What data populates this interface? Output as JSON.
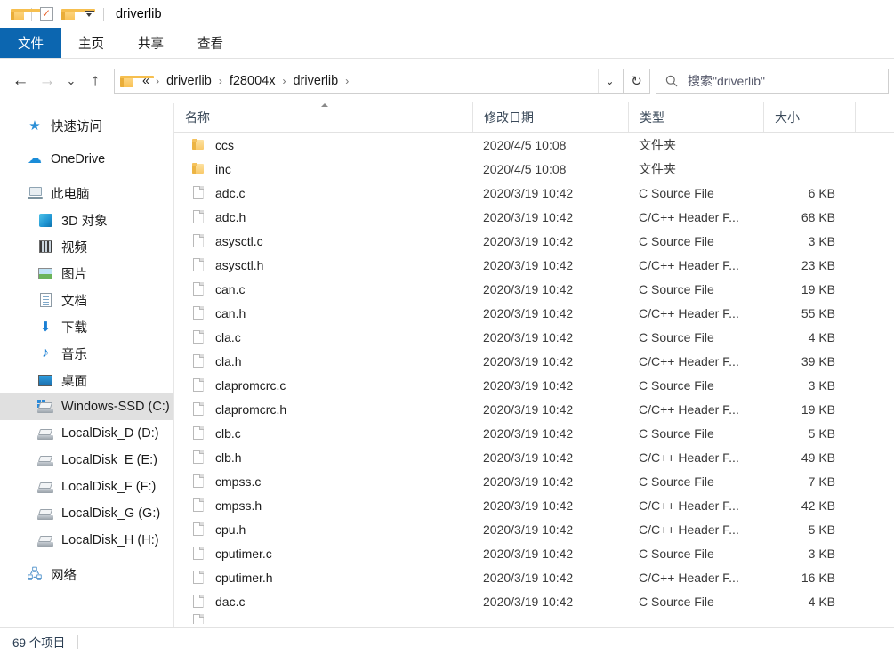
{
  "window": {
    "title": "driverlib"
  },
  "quick_access_toolbar": {
    "buttons": [
      {
        "name": "folder-icon",
        "label": ""
      },
      {
        "name": "properties-icon",
        "label": ""
      },
      {
        "name": "new-folder-icon",
        "label": ""
      },
      {
        "name": "customize-qat-icon",
        "label": ""
      }
    ]
  },
  "ribbon": {
    "tabs": [
      {
        "label": "文件",
        "active": true
      },
      {
        "label": "主页",
        "active": false
      },
      {
        "label": "共享",
        "active": false
      },
      {
        "label": "查看",
        "active": false
      }
    ]
  },
  "navigation": {
    "back_icon": "←",
    "forward_icon": "→",
    "recent_icon": "⌄",
    "up_icon": "↑",
    "refresh_icon": "↻",
    "dropdown_icon": "⌄"
  },
  "address_bar": {
    "ellipsis": "«",
    "separator": "›",
    "crumbs": [
      "driverlib",
      "f28004x",
      "driverlib"
    ]
  },
  "search": {
    "placeholder": "搜索\"driverlib\"",
    "value": "",
    "icon": "search-icon"
  },
  "sidebar": {
    "items": [
      {
        "label": "快速访问",
        "icon": "star-icon",
        "level": 1,
        "selected": false
      },
      {
        "label": "OneDrive",
        "icon": "cloud-icon",
        "level": 1,
        "selected": false
      },
      {
        "label": "此电脑",
        "icon": "computer-icon",
        "level": 1,
        "selected": false
      },
      {
        "label": "3D 对象",
        "icon": "cube-icon",
        "level": 2,
        "selected": false
      },
      {
        "label": "视频",
        "icon": "video-icon",
        "level": 2,
        "selected": false
      },
      {
        "label": "图片",
        "icon": "picture-icon",
        "level": 2,
        "selected": false
      },
      {
        "label": "文档",
        "icon": "document-icon",
        "level": 2,
        "selected": false
      },
      {
        "label": "下载",
        "icon": "download-icon",
        "level": 2,
        "selected": false
      },
      {
        "label": "音乐",
        "icon": "music-icon",
        "level": 2,
        "selected": false
      },
      {
        "label": "桌面",
        "icon": "desktop-icon",
        "level": 2,
        "selected": false
      },
      {
        "label": "Windows-SSD (C:)",
        "icon": "windows-drive-icon",
        "level": 2,
        "selected": true
      },
      {
        "label": "LocalDisk_D (D:)",
        "icon": "drive-icon",
        "level": 2,
        "selected": false
      },
      {
        "label": "LocalDisk_E (E:)",
        "icon": "drive-icon",
        "level": 2,
        "selected": false
      },
      {
        "label": "LocalDisk_F (F:)",
        "icon": "drive-icon",
        "level": 2,
        "selected": false
      },
      {
        "label": "LocalDisk_G (G:)",
        "icon": "drive-icon",
        "level": 2,
        "selected": false
      },
      {
        "label": "LocalDisk_H (H:)",
        "icon": "drive-icon",
        "level": 2,
        "selected": false
      },
      {
        "label": "网络",
        "icon": "network-icon",
        "level": 1,
        "selected": false
      }
    ]
  },
  "file_list": {
    "columns": [
      {
        "label": "名称",
        "key": "name",
        "sorted": true,
        "sort_direction": "asc"
      },
      {
        "label": "修改日期",
        "key": "date",
        "sorted": false
      },
      {
        "label": "类型",
        "key": "type",
        "sorted": false
      },
      {
        "label": "大小",
        "key": "size",
        "sorted": false
      }
    ],
    "rows": [
      {
        "name": "ccs",
        "date": "2020/4/5 10:08",
        "type": "文件夹",
        "size": "",
        "icon": "folder-icon"
      },
      {
        "name": "inc",
        "date": "2020/4/5 10:08",
        "type": "文件夹",
        "size": "",
        "icon": "folder-icon"
      },
      {
        "name": "adc.c",
        "date": "2020/3/19 10:42",
        "type": "C Source File",
        "size": "6 KB",
        "icon": "file-icon"
      },
      {
        "name": "adc.h",
        "date": "2020/3/19 10:42",
        "type": "C/C++ Header F...",
        "size": "68 KB",
        "icon": "file-icon"
      },
      {
        "name": "asysctl.c",
        "date": "2020/3/19 10:42",
        "type": "C Source File",
        "size": "3 KB",
        "icon": "file-icon"
      },
      {
        "name": "asysctl.h",
        "date": "2020/3/19 10:42",
        "type": "C/C++ Header F...",
        "size": "23 KB",
        "icon": "file-icon"
      },
      {
        "name": "can.c",
        "date": "2020/3/19 10:42",
        "type": "C Source File",
        "size": "19 KB",
        "icon": "file-icon"
      },
      {
        "name": "can.h",
        "date": "2020/3/19 10:42",
        "type": "C/C++ Header F...",
        "size": "55 KB",
        "icon": "file-icon"
      },
      {
        "name": "cla.c",
        "date": "2020/3/19 10:42",
        "type": "C Source File",
        "size": "4 KB",
        "icon": "file-icon"
      },
      {
        "name": "cla.h",
        "date": "2020/3/19 10:42",
        "type": "C/C++ Header F...",
        "size": "39 KB",
        "icon": "file-icon"
      },
      {
        "name": "clapromcrc.c",
        "date": "2020/3/19 10:42",
        "type": "C Source File",
        "size": "3 KB",
        "icon": "file-icon"
      },
      {
        "name": "clapromcrc.h",
        "date": "2020/3/19 10:42",
        "type": "C/C++ Header F...",
        "size": "19 KB",
        "icon": "file-icon"
      },
      {
        "name": "clb.c",
        "date": "2020/3/19 10:42",
        "type": "C Source File",
        "size": "5 KB",
        "icon": "file-icon"
      },
      {
        "name": "clb.h",
        "date": "2020/3/19 10:42",
        "type": "C/C++ Header F...",
        "size": "49 KB",
        "icon": "file-icon"
      },
      {
        "name": "cmpss.c",
        "date": "2020/3/19 10:42",
        "type": "C Source File",
        "size": "7 KB",
        "icon": "file-icon"
      },
      {
        "name": "cmpss.h",
        "date": "2020/3/19 10:42",
        "type": "C/C++ Header F...",
        "size": "42 KB",
        "icon": "file-icon"
      },
      {
        "name": "cpu.h",
        "date": "2020/3/19 10:42",
        "type": "C/C++ Header F...",
        "size": "5 KB",
        "icon": "file-icon"
      },
      {
        "name": "cputimer.c",
        "date": "2020/3/19 10:42",
        "type": "C Source File",
        "size": "3 KB",
        "icon": "file-icon"
      },
      {
        "name": "cputimer.h",
        "date": "2020/3/19 10:42",
        "type": "C/C++ Header F...",
        "size": "16 KB",
        "icon": "file-icon"
      },
      {
        "name": "dac.c",
        "date": "2020/3/19 10:42",
        "type": "C Source File",
        "size": "4 KB",
        "icon": "file-icon"
      }
    ]
  },
  "status_bar": {
    "item_count": "69 个项目"
  },
  "colors": {
    "accent": "#0c66b0",
    "selection": "#e0e0e0",
    "hover": "#e9f3fb",
    "folder": "#f9c255",
    "border": "#e2e2e2",
    "text": "#1b1b1b",
    "header_text": "#3b4a5a"
  }
}
